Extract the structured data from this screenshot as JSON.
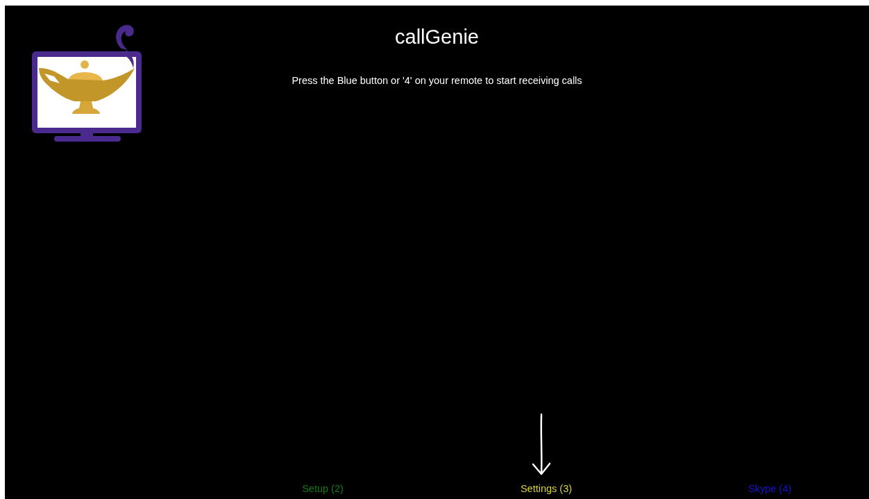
{
  "app": {
    "title": "callGenie",
    "message": "Press the Blue button or '4' on your remote to start receiving calls"
  },
  "buttons": [
    {
      "label": "Setup (2)",
      "color": "#137a13"
    },
    {
      "label": "Settings (3)",
      "color": "#d8d43a"
    },
    {
      "label": "Skype (4)",
      "color": "#1414d2"
    }
  ]
}
